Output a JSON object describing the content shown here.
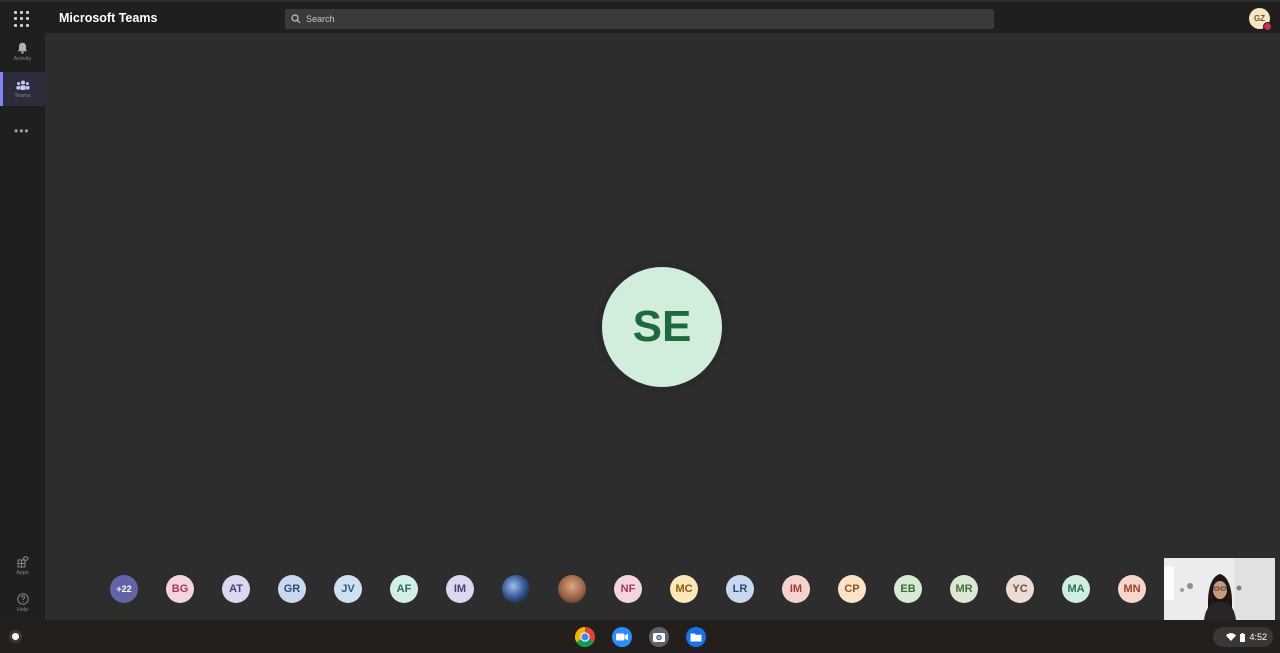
{
  "header": {
    "app_title": "Microsoft Teams",
    "search_placeholder": "Search",
    "user_initials": "GZ"
  },
  "rail": {
    "items": [
      {
        "label": "Activity",
        "icon": "bell-icon"
      },
      {
        "label": "Teams",
        "icon": "teams-icon",
        "active": true
      },
      {
        "label": "Apps",
        "icon": "apps-icon"
      },
      {
        "label": "Help",
        "icon": "help-icon"
      }
    ]
  },
  "meeting": {
    "main_participant_initials": "SE",
    "overflow_count": "+22",
    "participants": [
      {
        "initials": "BG",
        "bg": "#f4d4de",
        "fg": "#a23a5b"
      },
      {
        "initials": "AT",
        "bg": "#dcd6ee",
        "fg": "#4b3f7a"
      },
      {
        "initials": "GR",
        "bg": "#c9d8ee",
        "fg": "#2e4a75"
      },
      {
        "initials": "JV",
        "bg": "#cfe0f0",
        "fg": "#2e5b85"
      },
      {
        "initials": "AF",
        "bg": "#d3ede8",
        "fg": "#2d6e63"
      },
      {
        "initials": "IM",
        "bg": "#dcd6ee",
        "fg": "#4b3f7a"
      },
      {
        "initials": "",
        "photo": true,
        "bg": "#3b5b9c"
      },
      {
        "initials": "",
        "photo": true,
        "bg": "#b98a6e"
      },
      {
        "initials": "NF",
        "bg": "#f4d4de",
        "fg": "#a23a5b"
      },
      {
        "initials": "MC",
        "bg": "#fbe7b8",
        "fg": "#8a5c0f"
      },
      {
        "initials": "LR",
        "bg": "#c9d8ee",
        "fg": "#2e4a75"
      },
      {
        "initials": "IM",
        "bg": "#f5d3cf",
        "fg": "#9a3b31"
      },
      {
        "initials": "CP",
        "bg": "#fbe3c8",
        "fg": "#8a5523"
      },
      {
        "initials": "EB",
        "bg": "#d6ead5",
        "fg": "#3d6b39"
      },
      {
        "initials": "MR",
        "bg": "#dce8d6",
        "fg": "#4c6b3d"
      },
      {
        "initials": "YC",
        "bg": "#ecdcd6",
        "fg": "#6e4b3e"
      },
      {
        "initials": "MA",
        "bg": "#cfeee0",
        "fg": "#2e7054"
      },
      {
        "initials": "MN",
        "bg": "#f9d6cd",
        "fg": "#9a3f2a"
      }
    ]
  },
  "shelf": {
    "apps": [
      {
        "name": "chrome-icon"
      },
      {
        "name": "zoom-icon"
      },
      {
        "name": "camera-icon"
      },
      {
        "name": "files-icon"
      }
    ],
    "time": "4:52"
  }
}
